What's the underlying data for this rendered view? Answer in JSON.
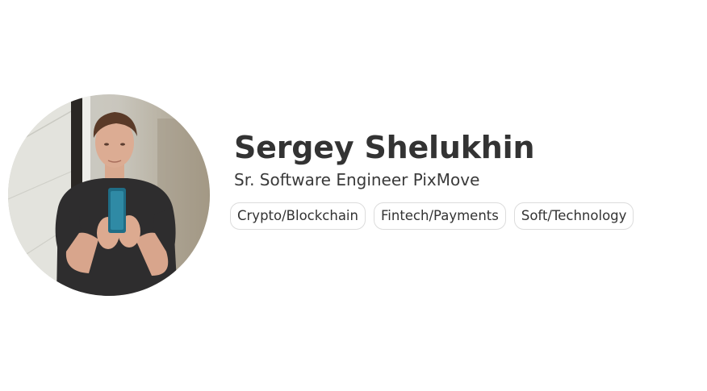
{
  "profile": {
    "name": "Sergey Shelukhin",
    "title": "Sr. Software Engineer PixMove",
    "avatar_icon": "profile-photo",
    "tags": [
      {
        "label": "Crypto/Blockchain"
      },
      {
        "label": "Fintech/Payments"
      },
      {
        "label": "Soft/Technology"
      }
    ]
  }
}
